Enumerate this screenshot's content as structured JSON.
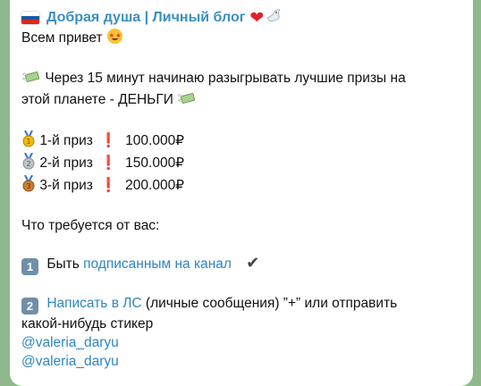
{
  "channel": {
    "title": "Добрая душа | Личный блог"
  },
  "message": {
    "greeting": "Всем привет",
    "announce_1": "Через 15 минут начинаю разыгрывать лучшие призы на",
    "announce_2": "этой планете - ДЕНЬГИ",
    "prizes": [
      {
        "place": "1-й приз",
        "amount": "100.000₽",
        "medal": "gold"
      },
      {
        "place": "2-й приз",
        "amount": "150.000₽",
        "medal": "silver"
      },
      {
        "place": "3-й приз",
        "amount": "200.000₽",
        "medal": "bronze"
      }
    ],
    "requirements_title": "Что требуется от вас:",
    "step1": {
      "num": "1",
      "text": "Быть",
      "link": "подписанным на канал"
    },
    "step2": {
      "num": "2",
      "link": "Написать в ЛС",
      "text": "(личные сообщения) ”+” или отправить",
      "text2": "какой-нибудь стикер"
    },
    "handles": [
      "@valeria_daryu",
      "@valeria_daryu"
    ]
  },
  "colors": {
    "link": "#2d86c4",
    "header": "#3a8fbf",
    "background": "#8fb98c"
  }
}
